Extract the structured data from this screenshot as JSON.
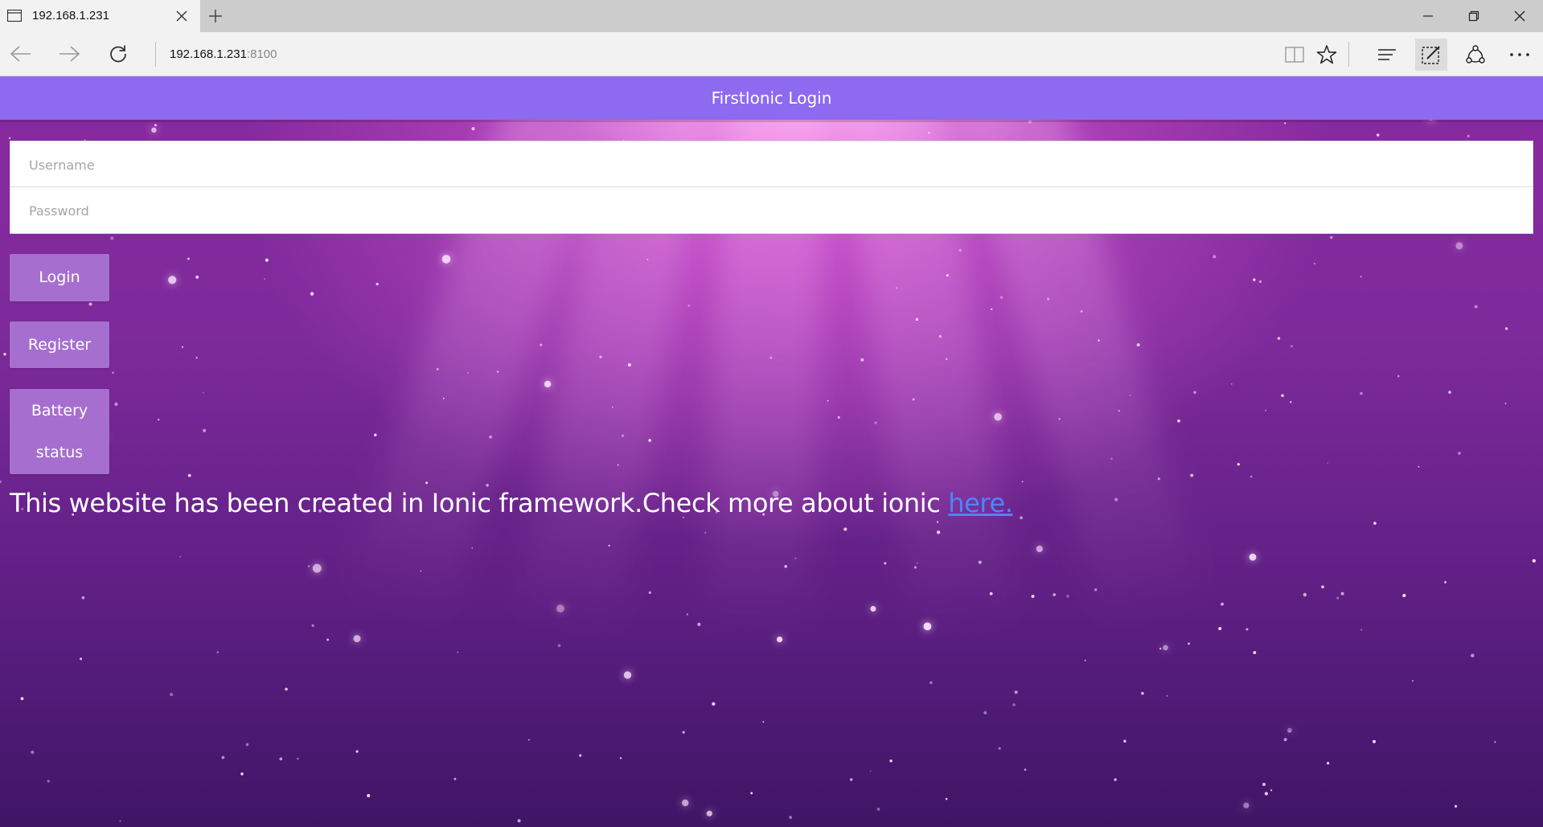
{
  "browser": {
    "tab_title": "192.168.1.231",
    "address_host": "192.168.1.231",
    "address_port": ":8100"
  },
  "app": {
    "header_title": "FirstIonic Login",
    "username_placeholder": "Username",
    "password_placeholder": "Password",
    "login_label": "Login",
    "register_label": "Register",
    "battery_label_line1": "Battery",
    "battery_label_line2": "status",
    "info_text": "This website has been created in Ionic framework.Check more about ionic ",
    "info_link": "here."
  },
  "colors": {
    "header": "#8d6af0",
    "button": "#a66fcf",
    "link": "#4a86ff"
  },
  "icons": [
    "page-icon",
    "close-icon",
    "plus-icon",
    "minimize-icon",
    "restore-icon",
    "window-close-icon",
    "back-arrow-icon",
    "forward-arrow-icon",
    "refresh-icon",
    "reading-view-icon",
    "star-icon",
    "hub-icon",
    "web-note-icon",
    "share-icon",
    "more-icon"
  ]
}
